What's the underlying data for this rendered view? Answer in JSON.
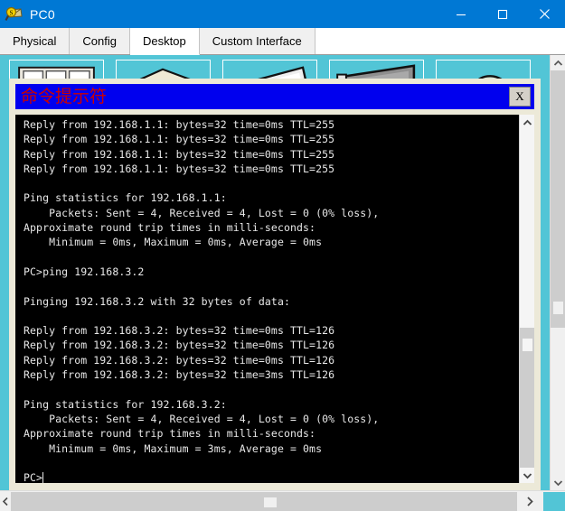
{
  "window": {
    "title": "PC0",
    "icon": "packet-tracer-inspect-icon",
    "controls": {
      "minimize": "minimize-icon",
      "maximize": "maximize-icon",
      "close": "close-icon"
    },
    "titlebar_color": "#0078d4"
  },
  "tabs": [
    {
      "label": "Physical",
      "active": false
    },
    {
      "label": "Config",
      "active": false
    },
    {
      "label": "Desktop",
      "active": true
    },
    {
      "label": "Custom Interface",
      "active": false
    }
  ],
  "desktop": {
    "background_color": "#52c5d6",
    "icons": [
      {
        "name": "ip-configuration-icon"
      },
      {
        "name": "dial-up-icon"
      },
      {
        "name": "terminal-icon"
      },
      {
        "name": "command-prompt-icon"
      },
      {
        "name": "web-browser-icon"
      }
    ]
  },
  "cmd_window": {
    "title": "命令提示符",
    "title_color": "#cc0000",
    "titlebar_color": "#0000ee",
    "close_label": "X",
    "terminal": {
      "background_color": "#000000",
      "text_color": "#e8e8e8",
      "lines": [
        "Reply from 192.168.1.1: bytes=32 time=0ms TTL=255",
        "Reply from 192.168.1.1: bytes=32 time=0ms TTL=255",
        "Reply from 192.168.1.1: bytes=32 time=0ms TTL=255",
        "Reply from 192.168.1.1: bytes=32 time=0ms TTL=255",
        "",
        "Ping statistics for 192.168.1.1:",
        "    Packets: Sent = 4, Received = 4, Lost = 0 (0% loss),",
        "Approximate round trip times in milli-seconds:",
        "    Minimum = 0ms, Maximum = 0ms, Average = 0ms",
        "",
        "PC>ping 192.168.3.2",
        "",
        "Pinging 192.168.3.2 with 32 bytes of data:",
        "",
        "Reply from 192.168.3.2: bytes=32 time=0ms TTL=126",
        "Reply from 192.168.3.2: bytes=32 time=0ms TTL=126",
        "Reply from 192.168.3.2: bytes=32 time=0ms TTL=126",
        "Reply from 192.168.3.2: bytes=32 time=3ms TTL=126",
        "",
        "Ping statistics for 192.168.3.2:",
        "    Packets: Sent = 4, Received = 4, Lost = 0 (0% loss),",
        "Approximate round trip times in milli-seconds:",
        "    Minimum = 0ms, Maximum = 3ms, Average = 0ms",
        "",
        "PC>"
      ],
      "prompt": "PC>"
    },
    "scrollbar": {
      "up_arrow": "chevron-up-icon",
      "down_arrow": "chevron-down-icon"
    }
  },
  "panel_scrollbars": {
    "vertical": {
      "up_arrow": "chevron-up-icon",
      "down_arrow": "chevron-down-icon"
    },
    "horizontal": {
      "left_arrow": "chevron-left-icon",
      "right_arrow": "chevron-right-icon"
    }
  }
}
